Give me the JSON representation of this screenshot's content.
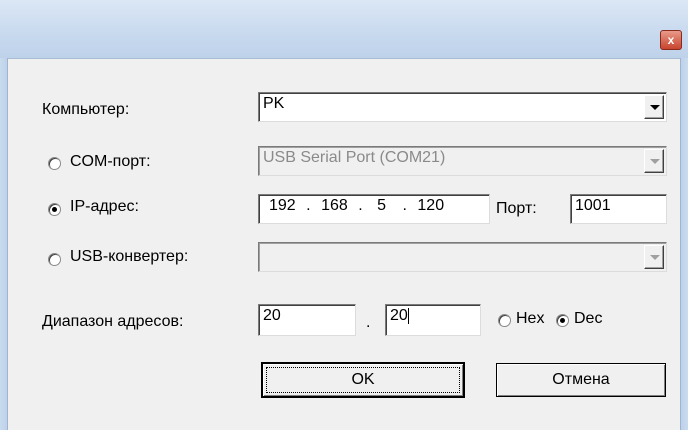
{
  "titlebar": {
    "close_glyph": "x"
  },
  "computer": {
    "label": "Компьютер:",
    "value": "PK"
  },
  "com_port": {
    "label": "COM-порт:",
    "value": "USB Serial Port (COM21)",
    "selected": false
  },
  "ip": {
    "label": "IP-адрес:",
    "octets": [
      "192",
      "168",
      "5",
      "120"
    ],
    "separator": ".",
    "selected": true,
    "port_label": "Порт:",
    "port_value": "1001"
  },
  "usb": {
    "label": "USB-конвертер:",
    "value": "",
    "selected": false
  },
  "range": {
    "label": "Диапазон адресов:",
    "from": "20",
    "separator": ".",
    "to": "20",
    "hex_label": "Hex",
    "dec_label": "Dec",
    "mode": "Dec"
  },
  "buttons": {
    "ok": "OK",
    "cancel": "Отмена"
  }
}
